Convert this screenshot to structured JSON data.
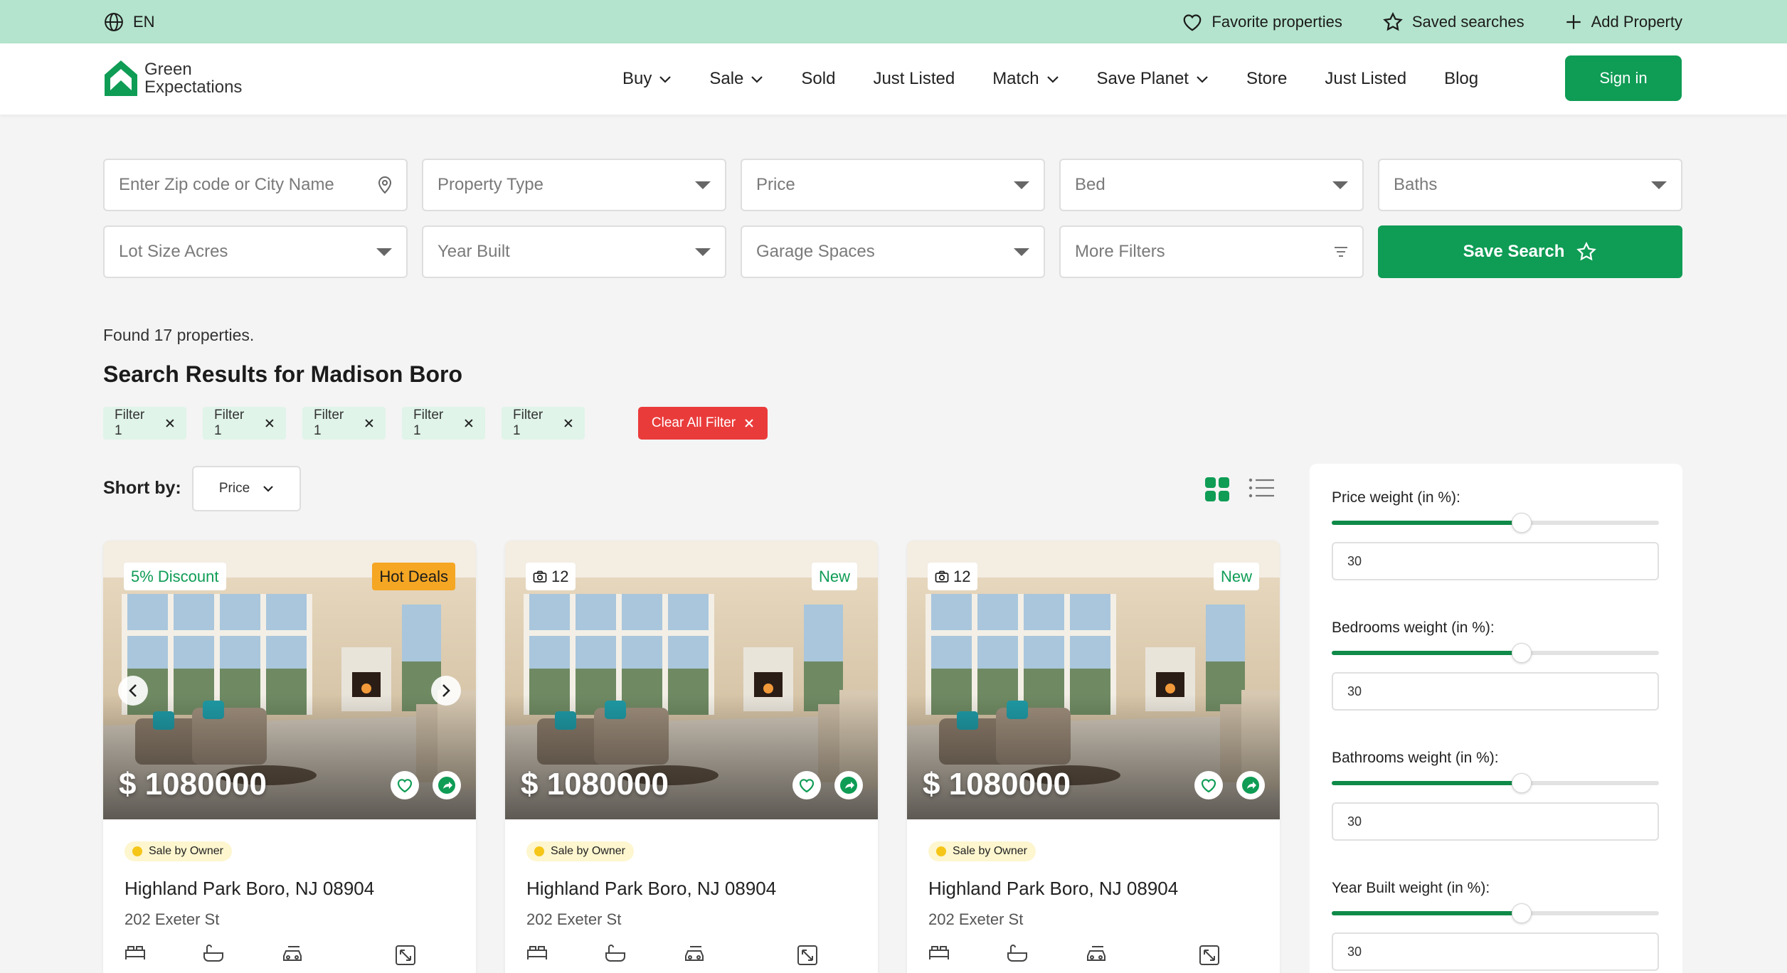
{
  "topbar": {
    "language": "EN",
    "favorites": "Favorite properties",
    "saved_searches": "Saved searches",
    "add_property": "Add Property",
    "icons": [
      "globe-icon",
      "heart-icon",
      "star-icon",
      "plus-icon"
    ]
  },
  "brand": {
    "line1": "Green",
    "line2": "Expectations"
  },
  "nav": {
    "items": [
      "Buy",
      "Sale",
      "Sold",
      "Just Listed",
      "Match",
      "Save Planet",
      "Store",
      "Just Listed",
      "Blog"
    ],
    "sign_in": "Sign in"
  },
  "filters": {
    "zip_placeholder": "Enter Zip code or City Name",
    "property_type": "Property Type",
    "price": "Price",
    "bed": "Bed",
    "baths": "Baths",
    "lot_size": "Lot Size Acres",
    "year_built": "Year Built",
    "garage": "Garage Spaces",
    "more_filters": "More Filters",
    "save_search": "Save Search"
  },
  "results": {
    "found": "Found 17 properties.",
    "title": "Search Results for Madison Boro",
    "chips": [
      "Filter 1",
      "Filter 1",
      "Filter 1",
      "Filter 1",
      "Filter 1"
    ],
    "clear_all": "Clear All Filter",
    "sort_label": "Short by:",
    "sort_value": "Price"
  },
  "cards": [
    {
      "tag_left": "5% Discount",
      "tag_right": "Hot Deals",
      "price": "$ 1080000",
      "badge": "Sale by Owner",
      "address": "Highland Park Boro, NJ 08904",
      "street": "202 Exeter St"
    },
    {
      "tag_left": "12",
      "tag_right": "New",
      "price": "$ 1080000",
      "badge": "Sale by Owner",
      "address": "Highland Park Boro, NJ 08904",
      "street": "202 Exeter St"
    },
    {
      "tag_left": "12",
      "tag_right": "New",
      "price": "$ 1080000",
      "badge": "Sale by Owner",
      "address": "Highland Park Boro, NJ 08904",
      "street": "202 Exeter St"
    }
  ],
  "weights": [
    {
      "label": "Price weight (in %):",
      "value": "30",
      "slider_percent": 58
    },
    {
      "label": "Bedrooms weight (in %):",
      "value": "30",
      "slider_percent": 58
    },
    {
      "label": "Bathrooms weight (in %):",
      "value": "30",
      "slider_percent": 58
    },
    {
      "label": "Year Built weight (in %):",
      "value": "30",
      "slider_percent": 58
    }
  ],
  "colors": {
    "brand_green": "#0f9c55",
    "topbar": "#b4e4cd",
    "clear_red": "#ea3b3b",
    "hot_orange": "#f5a623"
  }
}
